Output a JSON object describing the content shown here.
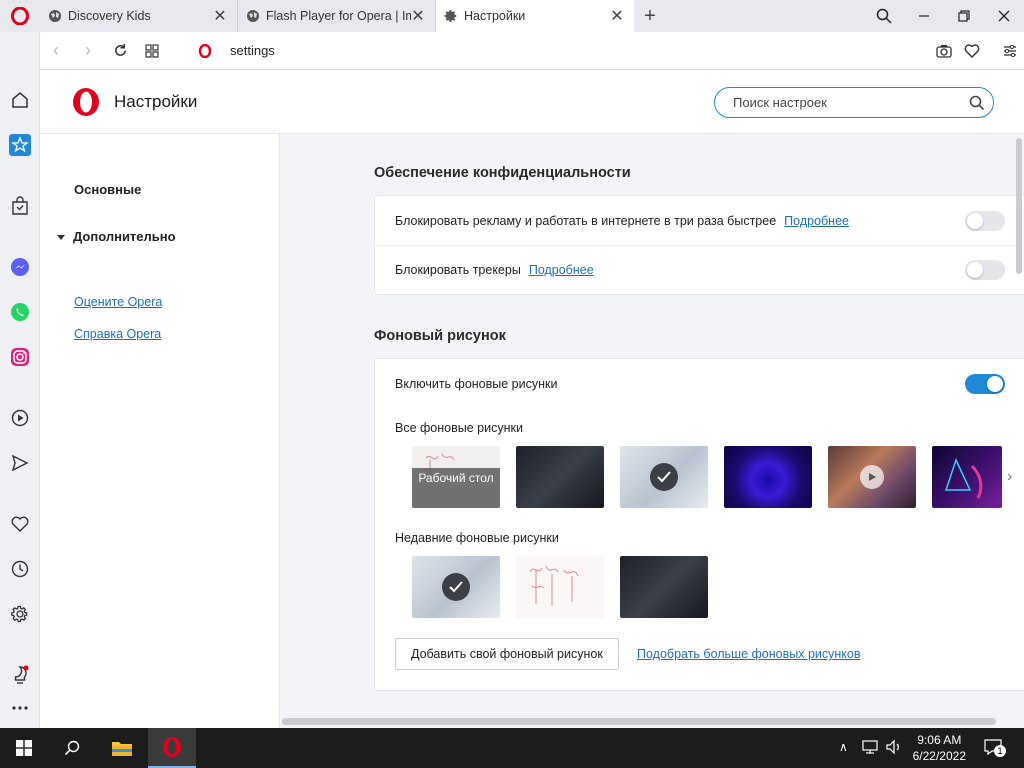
{
  "tabs": [
    {
      "title": "Discovery Kids",
      "icon": "globe-icon"
    },
    {
      "title": "Flash Player for Opera | Im",
      "icon": "globe-icon"
    },
    {
      "title": "Настройки",
      "icon": "gear-icon",
      "active": true
    }
  ],
  "address_bar": {
    "url": "settings"
  },
  "settings": {
    "title": "Настройки",
    "search_placeholder": "Поиск настроек",
    "nav": {
      "basic": "Основные",
      "advanced": "Дополнительно",
      "rate": "Оцените Opera",
      "help": "Справка Opera"
    },
    "privacy": {
      "title": "Обеспечение конфиденциальности",
      "block_ads": "Блокировать рекламу и работать в интернете в три раза быстрее",
      "block_ads_link": "Подробнее",
      "block_ads_enabled": false,
      "block_trackers": "Блокировать трекеры",
      "block_trackers_link": "Подробнее",
      "block_trackers_enabled": false
    },
    "wallpaper": {
      "title": "Фоновый рисунок",
      "enable_label": "Включить фоновые рисунки",
      "enabled": true,
      "all_label": "Все фоновые рисунки",
      "desktop_label": "Рабочий стол",
      "recent_label": "Недавние фоновые рисунки",
      "add_button": "Добавить свой фоновый рисунок",
      "more_link": "Подобрать больше фоновых рисунков"
    }
  },
  "taskbar": {
    "time": "9:06 AM",
    "date": "6/22/2022",
    "notification_count": "1"
  },
  "colors": {
    "accent": "#1f89d6",
    "opera_red": "#d0021b",
    "link": "#1f6fb8"
  }
}
